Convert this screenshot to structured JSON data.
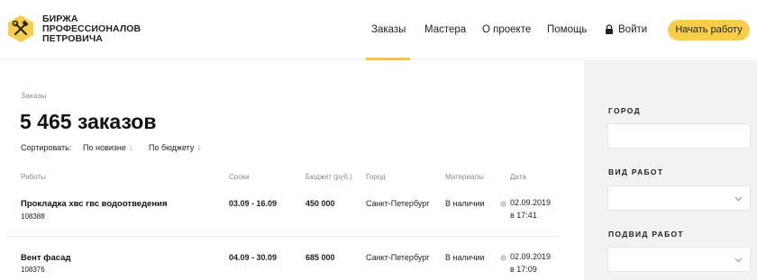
{
  "header": {
    "logo_lines": [
      "БИРЖА",
      "ПРОФЕССИОНАЛОВ",
      "ПЕТРОВИЧА"
    ],
    "logo_icon": "hammer-wrench-hexagon-icon",
    "nav": [
      "Заказы",
      "Мастера",
      "О проекте",
      "Помощь"
    ],
    "login_label": "Войти",
    "cta_label": "Начать работу",
    "accent_color": "#f8cd4c"
  },
  "main": {
    "breadcrumb": "Заказы",
    "title": "5 465 заказов",
    "sort": {
      "label": "Сортировать:",
      "options": [
        "По новизне",
        "По бюджету"
      ]
    },
    "columns": [
      "Работы",
      "Сроки",
      "Бюджет (руб.)",
      "Город",
      "Материалы",
      "Дата"
    ],
    "orders": [
      {
        "name": "Прокладка хвс гвс водоотведения",
        "id": "108388",
        "dates": "03.09 - 16.09",
        "budget": "450 000",
        "city": "Санкт-Петербург",
        "materials": "В наличии",
        "date": "02.09.2019",
        "time": "в 17:41"
      },
      {
        "name": "Вент фасад",
        "id": "108376",
        "dates": "04.09 - 30.09",
        "budget": "685 000",
        "city": "Санкт-Петербург",
        "materials": "В наличии",
        "date": "02.09.2019",
        "time": "в 17:09"
      }
    ]
  },
  "sidebar": {
    "filters": [
      {
        "label": "ГОРОД",
        "type": "text"
      },
      {
        "label": "ВИД РАБОТ",
        "type": "select"
      },
      {
        "label": "ПОДВИД РАБОТ",
        "type": "select"
      }
    ]
  }
}
